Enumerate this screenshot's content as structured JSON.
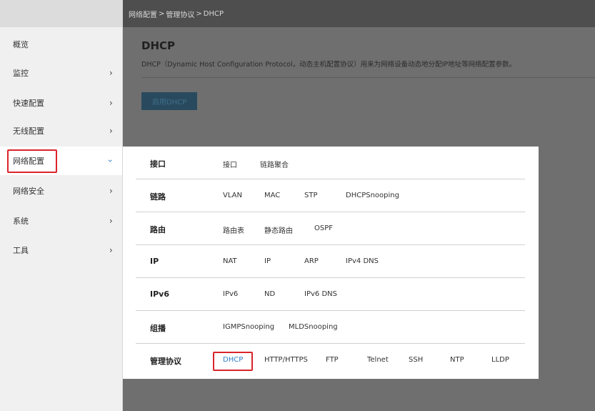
{
  "breadcrumb": [
    "网络配置",
    "管理协议",
    "DHCP"
  ],
  "breadcrumb_sep": ">",
  "sidebar": {
    "items": [
      {
        "label": "概览",
        "has_arrow": false
      },
      {
        "label": "监控",
        "has_arrow": true
      },
      {
        "label": "快速配置",
        "has_arrow": true
      },
      {
        "label": "无线配置",
        "has_arrow": true
      },
      {
        "label": "网络配置",
        "has_arrow": true,
        "active": true
      },
      {
        "label": "网络安全",
        "has_arrow": true
      },
      {
        "label": "系统",
        "has_arrow": true
      },
      {
        "label": "工具",
        "has_arrow": true
      }
    ],
    "arrow_glyph": "›"
  },
  "main": {
    "title": "DHCP",
    "description": "DHCP（Dynamic Host Configuration Protocol，动态主机配置协议）用来为网络设备动态地分配IP地址等网络配置参数。",
    "enable_button": "启用DHCP"
  },
  "menu": {
    "rows": [
      {
        "label": "接口",
        "links": [
          "接口",
          "链路聚合"
        ]
      },
      {
        "label": "链路",
        "links": [
          "VLAN",
          "MAC",
          "STP",
          "DHCPSnooping"
        ]
      },
      {
        "label": "路由",
        "links": [
          "路由表",
          "静态路由",
          "OSPF"
        ]
      },
      {
        "label": "IP",
        "links": [
          "NAT",
          "IP",
          "ARP",
          "IPv4 DNS"
        ]
      },
      {
        "label": "IPv6",
        "links": [
          "IPv6",
          "ND",
          "IPv6 DNS"
        ]
      },
      {
        "label": "组播",
        "links": [
          "IGMPSnooping",
          "MLDSnooping"
        ]
      },
      {
        "label": "管理协议",
        "links": [
          "DHCP",
          "HTTP/HTTPS",
          "FTP",
          "Telnet",
          "SSH",
          "NTP",
          "LLDP"
        ],
        "selected": "DHCP"
      }
    ]
  },
  "colors": {
    "highlight": "#d9252b",
    "link_selected": "#2f7fc8",
    "sidebar_bg": "#f0f0f0",
    "overlay": "#6f6f6f"
  }
}
